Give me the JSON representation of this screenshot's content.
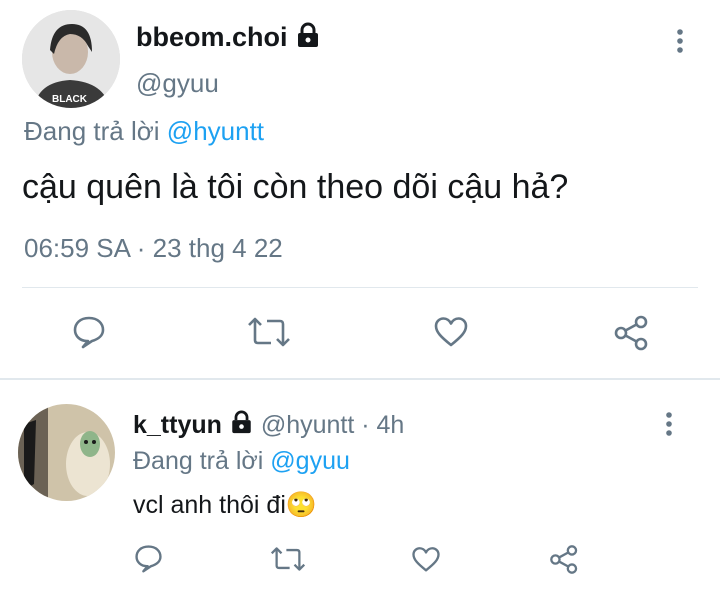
{
  "main_tweet": {
    "display_name": "bbeom.choi",
    "handle": "@gyuu",
    "replying_prefix": "Đang trả lời",
    "replying_to": "@hyuntt",
    "text": "cậu quên là tôi còn theo dõi cậu hả?",
    "timestamp": "06:59 SA · 23 thg 4 22",
    "avatar_shirt_text": "BLACK"
  },
  "reply_tweet": {
    "display_name": "k_ttyun",
    "handle": "@hyuntt",
    "time": "· 4h",
    "replying_prefix": "Đang trả lời",
    "replying_to": "@gyuu",
    "text": "vcl anh thôi đi",
    "emoji": "🙄"
  },
  "icons": {
    "reply": "comment-bubble-icon",
    "retweet": "retweet-icon",
    "like": "heart-icon",
    "share": "share-icon",
    "more": "more-vertical-icon",
    "lock": "lock-icon"
  },
  "colors": {
    "accent": "#1da1f2",
    "secondary_text": "#657786",
    "primary_text": "#14171a",
    "separator": "#e1e8ed"
  }
}
